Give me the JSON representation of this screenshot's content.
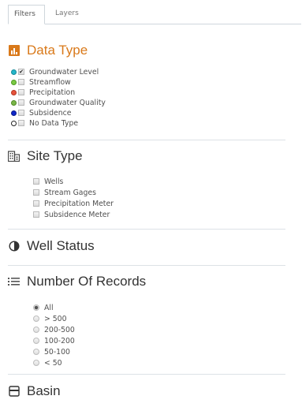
{
  "tabs": [
    "Filters",
    "Layers"
  ],
  "data_type": {
    "title": "Data Type",
    "items": [
      {
        "label": "Groundwater Level",
        "color": "#25b6c9",
        "checked": true
      },
      {
        "label": "Streamflow",
        "color": "#7ac943",
        "checked": false
      },
      {
        "label": "Precipitation",
        "color": "#e5533c",
        "checked": false
      },
      {
        "label": "Groundwater Quality",
        "color": "#7ab648",
        "checked": false
      },
      {
        "label": "Subsidence",
        "color": "#1028c9",
        "checked": false
      },
      {
        "label": "No Data Type",
        "color": "#ffffff",
        "checked": false
      }
    ]
  },
  "site_type": {
    "title": "Site Type",
    "items": [
      "Wells",
      "Stream Gages",
      "Precipitation Meter",
      "Subsidence Meter"
    ]
  },
  "well_status": {
    "title": "Well Status"
  },
  "records": {
    "title": "Number Of Records",
    "options": [
      "All",
      "> 500",
      "200-500",
      "100-200",
      "50-100",
      "< 50"
    ],
    "selected": "All"
  },
  "basin": {
    "title": "Basin"
  },
  "colors": {
    "accent": "#d9791a",
    "text": "#333333"
  }
}
